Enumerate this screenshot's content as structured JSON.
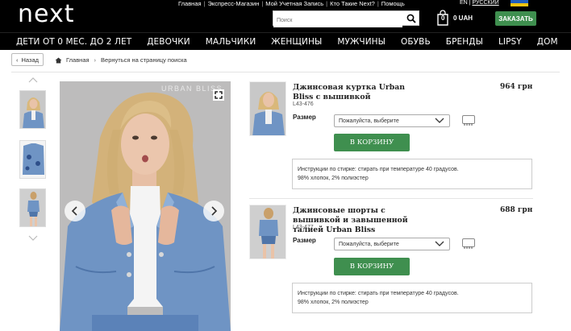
{
  "header": {
    "logo": "next",
    "top_links": [
      "Главная",
      "Экспресс-Магазин",
      "Мой Учетная Запись",
      "Кто Такие Next?",
      "Помощь"
    ],
    "lang_en": "EN",
    "lang_ru": "РУССКИЙ",
    "search_placeholder": "Поиск",
    "bag_count": "0",
    "bag_total": "0 UAH",
    "checkout_label": "ЗАКАЗАТЬ"
  },
  "nav": {
    "items": [
      "ДЕТИ ОТ 0 МЕС. ДО 2 ЛЕТ",
      "ДЕВОЧКИ",
      "МАЛЬЧИКИ",
      "ЖЕНЩИНЫ",
      "МУЖЧИНЫ",
      "ОБУВЬ",
      "БРЕНДЫ",
      "LIPSY",
      "ДОМ"
    ]
  },
  "breadcrumb": {
    "back_label": "Назад",
    "home": "Главная",
    "return": "Вернуться на страницу поиска"
  },
  "gallery": {
    "brand_watermark": "URBAN BLISS"
  },
  "products": [
    {
      "title": "Джинсовая куртка Urban Bliss с вышивкой",
      "code": "L43-476",
      "price": "964 грн",
      "size_label": "Размер",
      "size_select": "Пожалуйста, выберите",
      "add_label": "В КОРЗИНУ",
      "care_line1": "Инструкции по стирке: стирать при температуре 40 градусов.",
      "care_line2": "98% хлопок, 2% полиэстер"
    },
    {
      "title": "Джинсовые шорты с вышивкой и завышенной талией Urban Bliss",
      "code": "L43-477",
      "price": "688 грн",
      "size_label": "Размер",
      "size_select": "Пожалуйста, выберите",
      "add_label": "В КОРЗИНУ",
      "care_line1": "Инструкции по стирке: стирать при температуре 40 градусов.",
      "care_line2": "98% хлопок, 2% полиэстер"
    }
  ],
  "colors": {
    "header_bg": "#000000",
    "accent_green": "#3f8f4f",
    "denim": "#6f94c4"
  }
}
